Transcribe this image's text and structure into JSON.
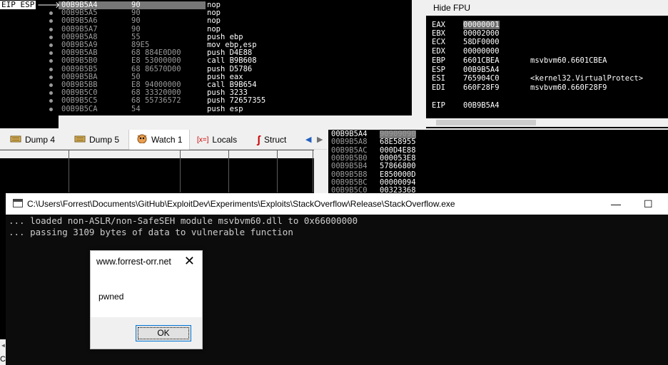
{
  "disasm": {
    "eip_label": "EIP ESP",
    "rows": [
      {
        "addr": "00B9B5A4",
        "hex": "90",
        "ins": "nop",
        "selected": true
      },
      {
        "addr": "00B9B5A5",
        "hex": "90",
        "ins": "nop"
      },
      {
        "addr": "00B9B5A6",
        "hex": "90",
        "ins": "nop"
      },
      {
        "addr": "00B9B5A7",
        "hex": "90",
        "ins": "nop"
      },
      {
        "addr": "00B9B5A8",
        "hex": "55",
        "ins": "push ebp"
      },
      {
        "addr": "00B9B5A9",
        "hex": "89E5",
        "ins": "mov ebp,esp"
      },
      {
        "addr": "00B9B5AB",
        "hex": "68 884E0D00",
        "ins": "push D4E88"
      },
      {
        "addr": "00B9B5B0",
        "hex": "E8 53000000",
        "ins": "call B9B608"
      },
      {
        "addr": "00B9B5B5",
        "hex": "68 86570D00",
        "ins": "push D5786"
      },
      {
        "addr": "00B9B5BA",
        "hex": "50",
        "ins": "push eax"
      },
      {
        "addr": "00B9B5BB",
        "hex": "E8 94000000",
        "ins": "call B9B654"
      },
      {
        "addr": "00B9B5C0",
        "hex": "68 33320000",
        "ins": "push 3233"
      },
      {
        "addr": "00B9B5C5",
        "hex": "68 55736572",
        "ins": "push 72657355"
      },
      {
        "addr": "00B9B5CA",
        "hex": "54",
        "ins": "push esp"
      }
    ]
  },
  "registers": {
    "header": "Hide FPU",
    "rows": [
      {
        "name": "EAX",
        "value": "00000001",
        "comment": "",
        "highlight": true
      },
      {
        "name": "EBX",
        "value": "00002000",
        "comment": ""
      },
      {
        "name": "ECX",
        "value": "58DF0000",
        "comment": ""
      },
      {
        "name": "EDX",
        "value": "00000000",
        "comment": ""
      },
      {
        "name": "EBP",
        "value": "6601CBEA",
        "comment": "msvbvm60.6601CBEA"
      },
      {
        "name": "ESP",
        "value": "00B9B5A4",
        "comment": ""
      },
      {
        "name": "ESI",
        "value": "765904C0",
        "comment": "<kernel32.VirtualProtect>"
      },
      {
        "name": "EDI",
        "value": "660F28F9",
        "comment": "msvbvm60.660F28F9"
      },
      {
        "name": "EIP",
        "value": "00B9B5A4",
        "comment": ""
      }
    ]
  },
  "tabs": [
    {
      "label": "Dump 4",
      "icon": "dump-icon"
    },
    {
      "label": "Dump 5",
      "icon": "dump-icon"
    },
    {
      "label": "Watch 1",
      "icon": "watch-icon",
      "active": true
    },
    {
      "label": "Locals",
      "icon": "locals-icon"
    },
    {
      "label": "Struct",
      "icon": "struct-icon"
    }
  ],
  "stack": {
    "rows": [
      {
        "addr": "00B9B5A4",
        "value": "90909090",
        "selected": true
      },
      {
        "addr": "00B9B5A8",
        "value": "68E58955"
      },
      {
        "addr": "00B9B5AC",
        "value": "000D4E88"
      },
      {
        "addr": "00B9B5B0",
        "value": "000053E8"
      },
      {
        "addr": "00B9B5B4",
        "value": "57866800"
      },
      {
        "addr": "00B9B5B8",
        "value": "E850000D"
      },
      {
        "addr": "00B9B5BC",
        "value": "00000094"
      },
      {
        "addr": "00B9B5C0",
        "value": "00323368"
      }
    ]
  },
  "console": {
    "title": "C:\\Users\\Forrest\\Documents\\GitHub\\ExploitDev\\Experiments\\Exploits\\StackOverflow\\Release\\StackOverflow.exe",
    "lines": [
      "... loaded non-ASLR/non-SafeSEH module msvbvm60.dll to 0x66000000",
      "... passing 3109 bytes of data to vulnerable function"
    ],
    "minimize": "—",
    "maximize": "☐"
  },
  "dialog": {
    "title": "www.forrest-orr.net",
    "close": "✕",
    "message": "pwned",
    "ok_label": "OK"
  },
  "left_edge_char": "C"
}
